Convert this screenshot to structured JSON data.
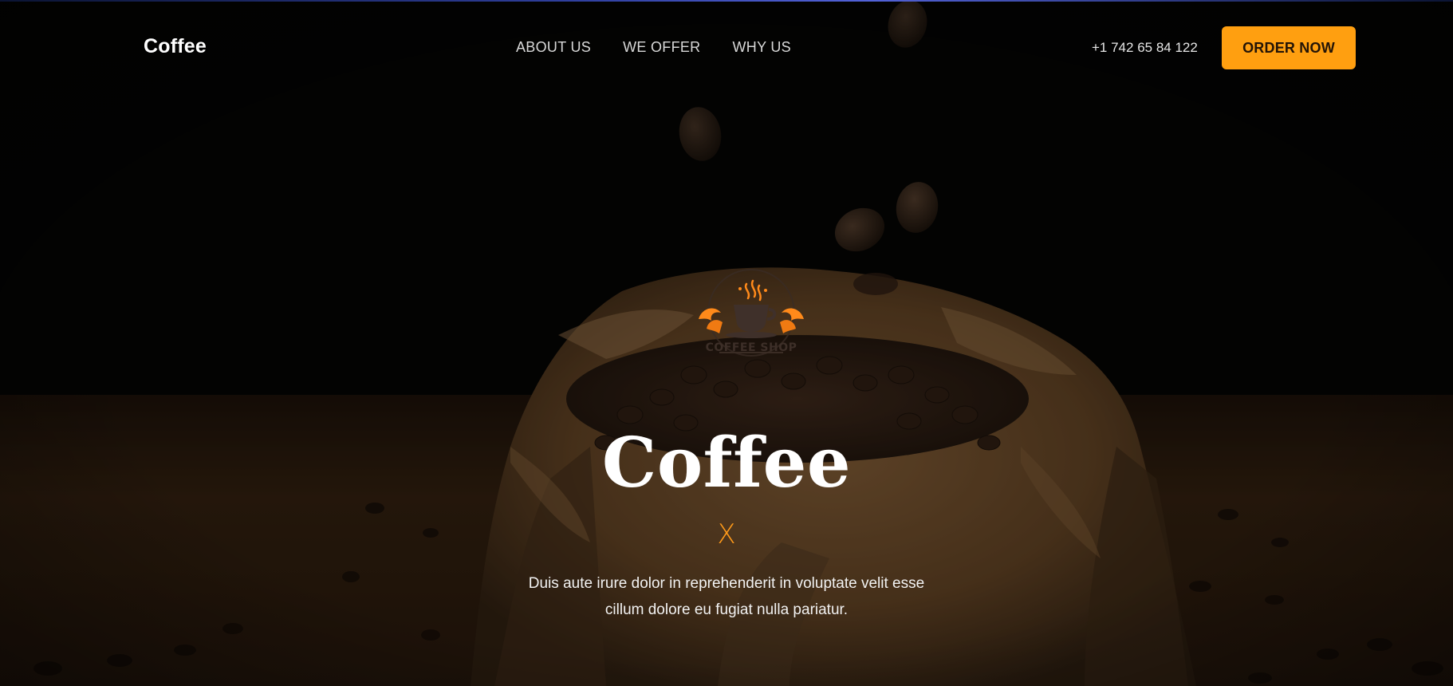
{
  "header": {
    "logo": "Coffee",
    "nav": [
      "ABOUT US",
      "WE OFFER",
      "WHY US"
    ],
    "phone": "+1 742 65 84 122",
    "cta": "ORDER NOW"
  },
  "emblem": {
    "label": "COFFEE SHOP",
    "icon": "coffee-cup-icon"
  },
  "hero": {
    "title": "Coffee",
    "divider": "X",
    "text_line1": "Duis aute irure dolor in reprehenderit in voluptate velit esse",
    "text_line2": "cillum dolore eu fugiat nulla pariatur."
  },
  "colors": {
    "accent": "#ff9f10",
    "background": "#050403",
    "divider": "#ff9a1a"
  }
}
